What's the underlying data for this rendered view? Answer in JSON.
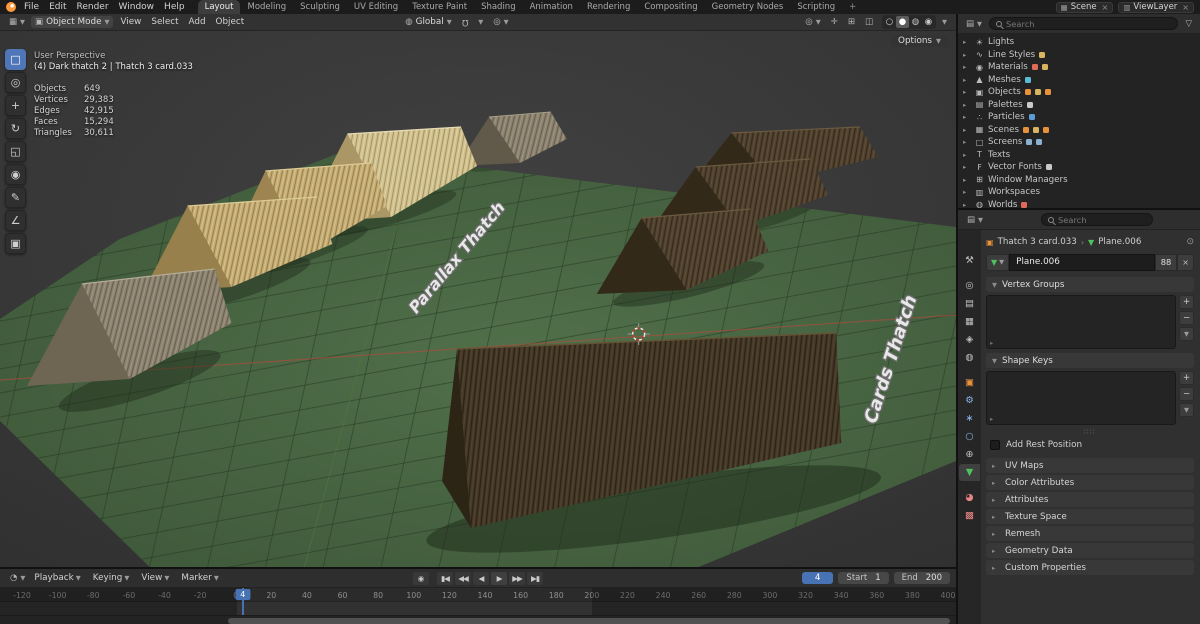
{
  "topbar": {
    "menus": [
      "File",
      "Edit",
      "Render",
      "Window",
      "Help"
    ],
    "workspaces": [
      "Layout",
      "Modeling",
      "Sculpting",
      "UV Editing",
      "Texture Paint",
      "Shading",
      "Animation",
      "Rendering",
      "Compositing",
      "Geometry Nodes",
      "Scripting"
    ],
    "active_workspace": "Layout",
    "add_workspace_label": "+",
    "scene_label": "Scene",
    "viewlayer_label": "ViewLayer"
  },
  "viewport_header": {
    "mode_selector": "Object Mode",
    "menus": [
      "View",
      "Select",
      "Add",
      "Object"
    ],
    "transform_orientation": "Global",
    "options_label": "Options"
  },
  "toolbar": {
    "tools": [
      "select-box",
      "cursor",
      "move",
      "rotate",
      "scale",
      "transform",
      "annotate",
      "measure",
      "add-cube"
    ],
    "active_tool": "select-box"
  },
  "viewport_overlay": {
    "view_label": "User Perspective",
    "active_object": "(4) Dark thatch 2 | Thatch 3 card.033",
    "stats": [
      {
        "label": "Objects",
        "value": "649"
      },
      {
        "label": "Vertices",
        "value": "29,383"
      },
      {
        "label": "Edges",
        "value": "42,915"
      },
      {
        "label": "Faces",
        "value": "15,294"
      },
      {
        "label": "Triangles",
        "value": "30,611"
      }
    ]
  },
  "scene": {
    "text_parallax": "Parallax Thatch",
    "text_cards": "Cards Thatch"
  },
  "outliner": {
    "search_placeholder": "Search",
    "items": [
      {
        "label": "Lights",
        "icon": "light",
        "badges": []
      },
      {
        "label": "Line Styles",
        "icon": "linestyle",
        "badges": [
          "#d8b55e"
        ]
      },
      {
        "label": "Materials",
        "icon": "material",
        "badges": [
          "#e06a5a",
          "#d8b55e"
        ]
      },
      {
        "label": "Meshes",
        "icon": "mesh",
        "badges": [
          "#5bbcd6"
        ]
      },
      {
        "label": "Objects",
        "icon": "object",
        "badges": [
          "#e8923c",
          "#d8b55e",
          "#e8923c"
        ]
      },
      {
        "label": "Palettes",
        "icon": "palette",
        "badges": [
          "#c9c9c9"
        ]
      },
      {
        "label": "Particles",
        "icon": "particles",
        "badges": [
          "#5b9bd6"
        ]
      },
      {
        "label": "Scenes",
        "icon": "scene",
        "badges": [
          "#e8923c",
          "#d8b55e",
          "#e8923c"
        ]
      },
      {
        "label": "Screens",
        "icon": "screen",
        "badges": [
          "#8ab0d4",
          "#8ab0d4"
        ]
      },
      {
        "label": "Texts",
        "icon": "text",
        "badges": []
      },
      {
        "label": "Vector Fonts",
        "icon": "font",
        "badges": [
          "#c9c9c9"
        ]
      },
      {
        "label": "Window Managers",
        "icon": "wm",
        "badges": []
      },
      {
        "label": "Workspaces",
        "icon": "workspace",
        "badges": []
      },
      {
        "label": "Worlds",
        "icon": "world",
        "badges": [
          "#e06a5a"
        ]
      }
    ]
  },
  "properties": {
    "search_placeholder": "Search",
    "breadcrumb": {
      "object": "Thatch 3 card.033",
      "data": "Plane.006"
    },
    "name_field_value": "Plane.006",
    "users_count": "88",
    "tabs": [
      "tool",
      "render",
      "output",
      "view-layer",
      "scene",
      "world",
      "object",
      "modifiers",
      "particles",
      "physics",
      "constraints",
      "data",
      "material",
      "texture"
    ],
    "active_tab": "data",
    "sections": {
      "vertex_groups_label": "Vertex Groups",
      "shape_keys_label": "Shape Keys",
      "add_rest_position_label": "Add Rest Position",
      "collapsed": [
        "UV Maps",
        "Color Attributes",
        "Attributes",
        "Texture Space",
        "Remesh",
        "Geometry Data",
        "Custom Properties"
      ]
    }
  },
  "timeline": {
    "menus": [
      "Playback",
      "Keying",
      "View",
      "Marker"
    ],
    "controls": [
      "jump-start",
      "prev-keyframe",
      "play-reverse",
      "play",
      "next-keyframe",
      "jump-end"
    ],
    "current_frame": 4,
    "start_label": "Start",
    "start_value": 1,
    "end_label": "End",
    "end_value": 200,
    "range_min": -120,
    "range_max": 400,
    "tick_step": 20
  },
  "colors": {
    "accent": "#4772b3",
    "ground_green": "#4b6a44"
  }
}
